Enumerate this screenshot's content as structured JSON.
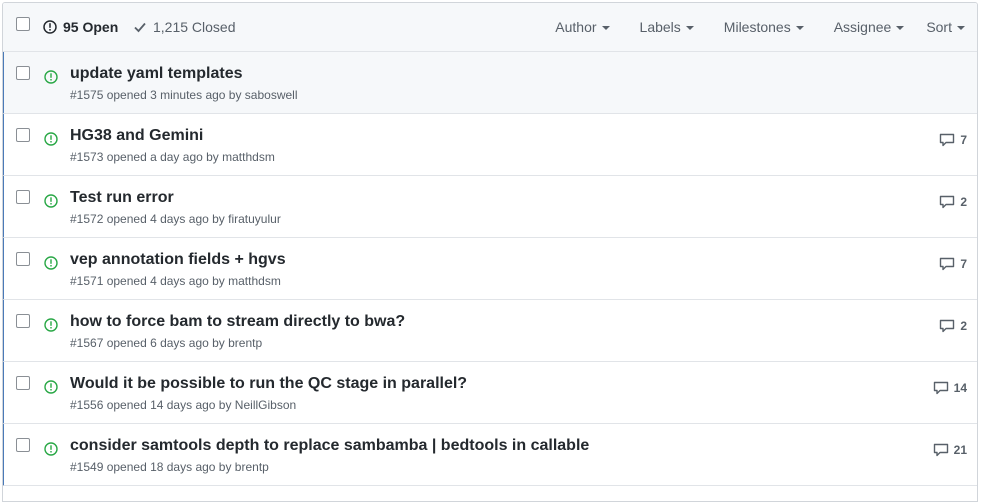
{
  "header": {
    "open_label": "95 Open",
    "closed_label": "1,215 Closed",
    "filters": [
      "Author",
      "Labels",
      "Milestones",
      "Assignee",
      "Sort"
    ]
  },
  "colors": {
    "open_green": "#28a745",
    "row_accent": "#4a7ab8"
  },
  "issues": [
    {
      "title": "update yaml templates",
      "meta": "#1575 opened 3 minutes ago by saboswell",
      "comments": ""
    },
    {
      "title": "HG38 and Gemini",
      "meta": "#1573 opened a day ago by matthdsm",
      "comments": "7"
    },
    {
      "title": "Test run error",
      "meta": "#1572 opened 4 days ago by firatuyulur",
      "comments": "2"
    },
    {
      "title": "vep annotation fields + hgvs",
      "meta": "#1571 opened 4 days ago by matthdsm",
      "comments": "7"
    },
    {
      "title": "how to force bam to stream directly to bwa?",
      "meta": "#1567 opened 6 days ago by brentp",
      "comments": "2"
    },
    {
      "title": "Would it be possible to run the QC stage in parallel?",
      "meta": "#1556 opened 14 days ago by NeillGibson",
      "comments": "14"
    },
    {
      "title": "consider samtools depth to replace sambamba | bedtools in callable",
      "meta": "#1549 opened 18 days ago by brentp",
      "comments": "21"
    }
  ]
}
